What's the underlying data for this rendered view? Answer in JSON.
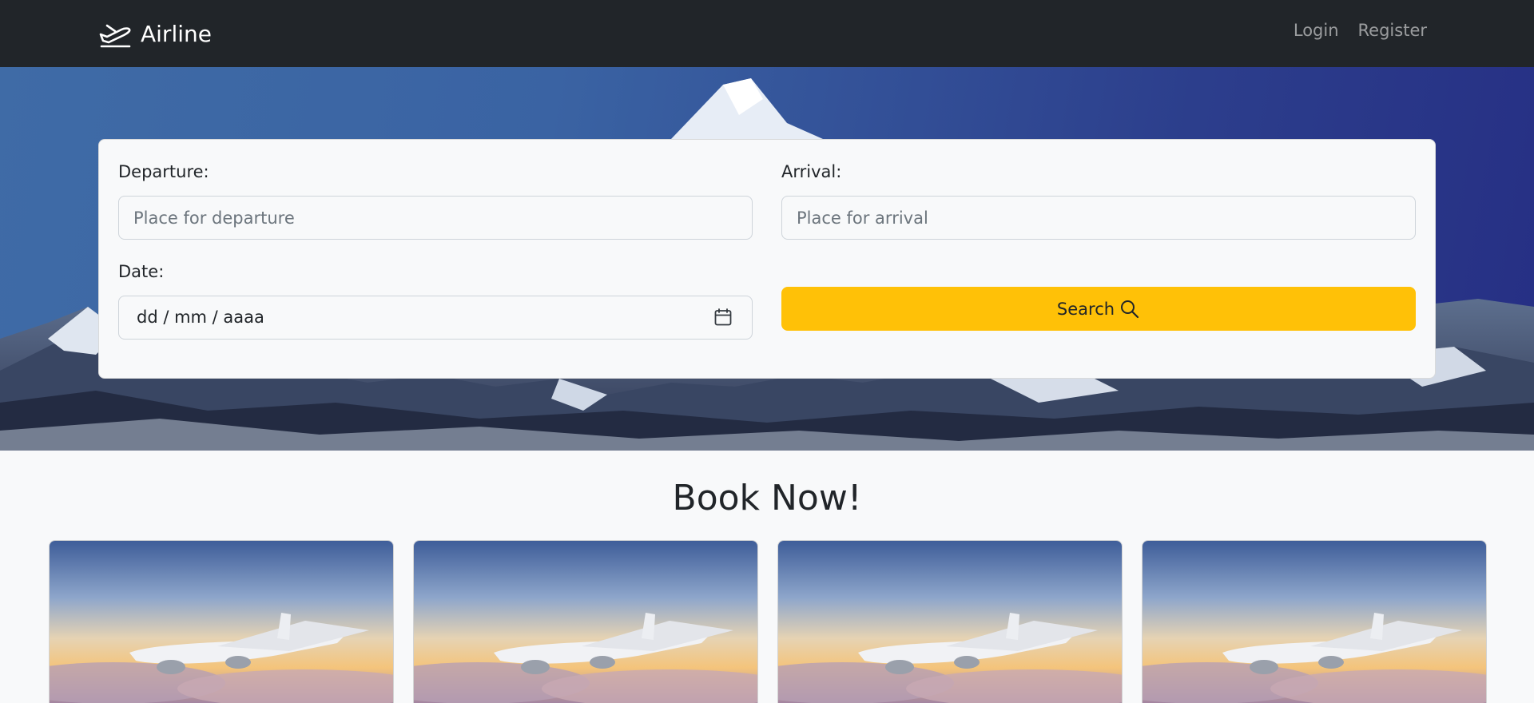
{
  "navbar": {
    "brand": "Airline",
    "links": [
      "Login",
      "Register"
    ]
  },
  "search": {
    "departure_label": "Departure:",
    "departure_placeholder": "Place for departure",
    "arrival_label": "Arrival:",
    "arrival_placeholder": "Place for arrival",
    "date_label": "Date:",
    "date_value": "dd / mm / aaaa",
    "search_label": "Search"
  },
  "section": {
    "title": "Book Now!"
  },
  "cards": [
    {
      "image": "airplane-image"
    },
    {
      "image": "airplane-image"
    },
    {
      "image": "airplane-image"
    },
    {
      "image": "airplane-image"
    }
  ],
  "colors": {
    "navbar": "#212529",
    "accent": "#ffc107",
    "background": "#f8f9fa"
  }
}
